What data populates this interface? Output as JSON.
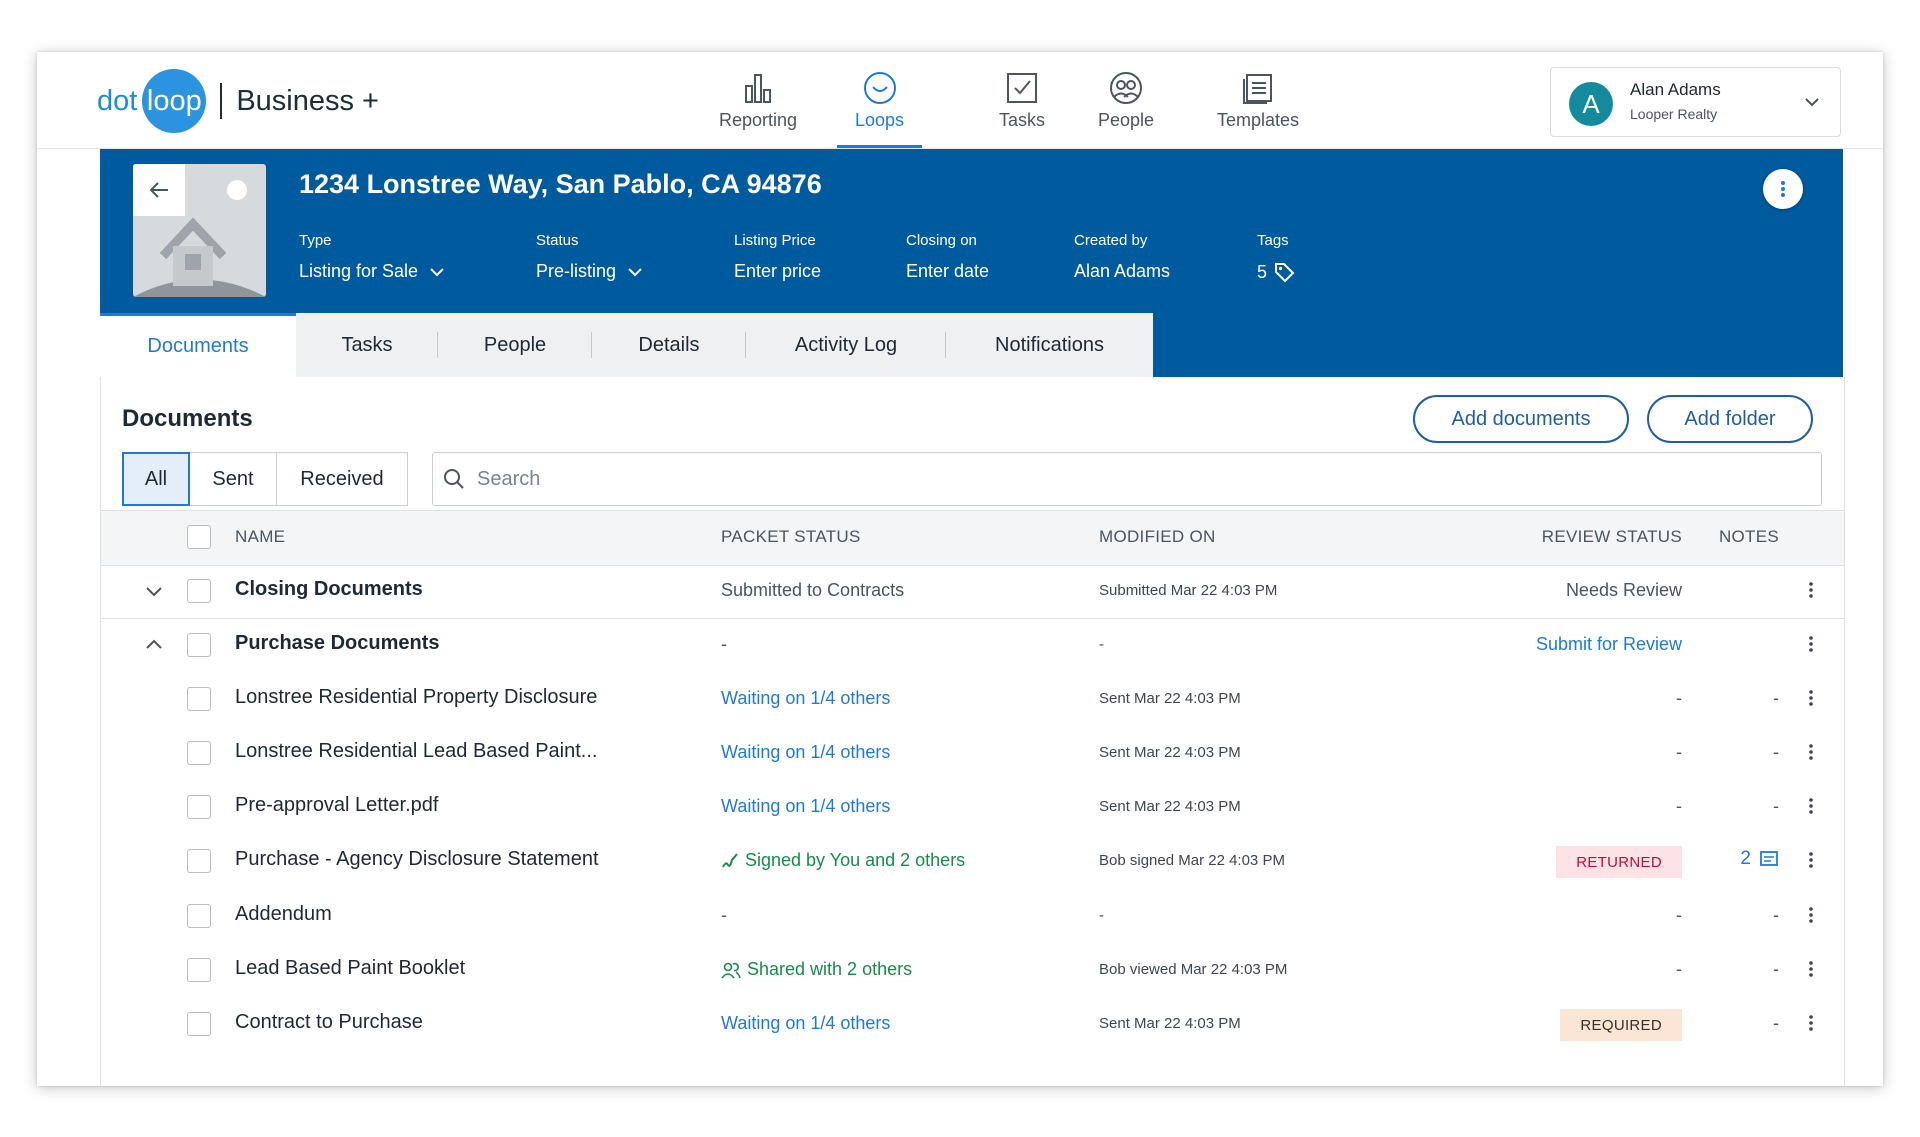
{
  "brand": {
    "dot": "dot",
    "loop": "loop",
    "plan": "Business +"
  },
  "nav": [
    {
      "label": "Reporting",
      "icon": "bar-chart-icon",
      "active": false
    },
    {
      "label": "Loops",
      "icon": "loops-icon",
      "active": true
    },
    {
      "label": "Tasks",
      "icon": "checkbox-icon",
      "active": false
    },
    {
      "label": "People",
      "icon": "people-icon",
      "active": false
    },
    {
      "label": "Templates",
      "icon": "templates-icon",
      "active": false
    }
  ],
  "user": {
    "initial": "A",
    "name": "Alan Adams",
    "company": "Looper Realty"
  },
  "loop": {
    "address": "1234 Lonstree Way, San Pablo, CA 94876",
    "meta": [
      {
        "key": "Type",
        "value": "Listing for Sale"
      },
      {
        "key": "Status",
        "value": "Pre-listing"
      },
      {
        "key": "Listing Price",
        "value": "Enter price"
      },
      {
        "key": "Closing on",
        "value": "Enter date"
      },
      {
        "key": "Created by",
        "value": "Alan Adams"
      },
      {
        "key": "Tags",
        "value": "5"
      }
    ]
  },
  "tabs": [
    "Documents",
    "Tasks",
    "People",
    "Details",
    "Activity Log",
    "Notifications"
  ],
  "documents": {
    "title": "Documents",
    "add_documents": "Add documents",
    "add_folder": "Add folder",
    "filters": [
      "All",
      "Sent",
      "Received"
    ],
    "search_placeholder": "Search",
    "columns": {
      "name": "NAME",
      "packet_status": "PACKET STATUS",
      "modified_on": "MODIFIED ON",
      "review_status": "REVIEW STATUS",
      "notes": "NOTES"
    },
    "rows": [
      {
        "name": "Closing Documents",
        "status": "Submitted to Contracts",
        "modified": "Submitted Mar 22 4:03 PM",
        "review": "Needs Review",
        "notes": ""
      },
      {
        "name": "Purchase Documents",
        "status": "-",
        "modified": "-",
        "review": "Submit for Review",
        "notes": ""
      },
      {
        "name": "Lonstree Residential Property Disclosure",
        "status": "Waiting on 1/4 others",
        "modified": "Sent Mar 22 4:03 PM",
        "review": "-",
        "notes": "-"
      },
      {
        "name": "Lonstree Residential Lead Based Paint...",
        "status": "Waiting on 1/4 others",
        "modified": "Sent Mar 22 4:03 PM",
        "review": "-",
        "notes": "-"
      },
      {
        "name": "Pre-approval Letter.pdf",
        "status": "Waiting on 1/4 others",
        "modified": "Sent Mar 22 4:03 PM",
        "review": "-",
        "notes": "-"
      },
      {
        "name": "Purchase - Agency Disclosure Statement",
        "status": "Signed by You and 2 others",
        "modified": "Bob signed Mar 22 4:03 PM",
        "review": "RETURNED",
        "notes": "2"
      },
      {
        "name": "Addendum",
        "status": "-",
        "modified": "-",
        "review": "-",
        "notes": "-"
      },
      {
        "name": "Lead Based Paint Booklet",
        "status": "Shared with 2 others",
        "modified": "Bob viewed Mar 22 4:03 PM",
        "review": "-",
        "notes": "-"
      },
      {
        "name": "Contract to Purchase",
        "status": "Waiting on 1/4 others",
        "modified": "Sent Mar 22 4:03 PM",
        "review": "REQUIRED",
        "notes": "-"
      }
    ]
  },
  "colors": {
    "banner": "#005a9e",
    "accent": "#1f7ad6",
    "returned_bg": "#fde3e6",
    "required_bg": "#fbe6d6"
  }
}
